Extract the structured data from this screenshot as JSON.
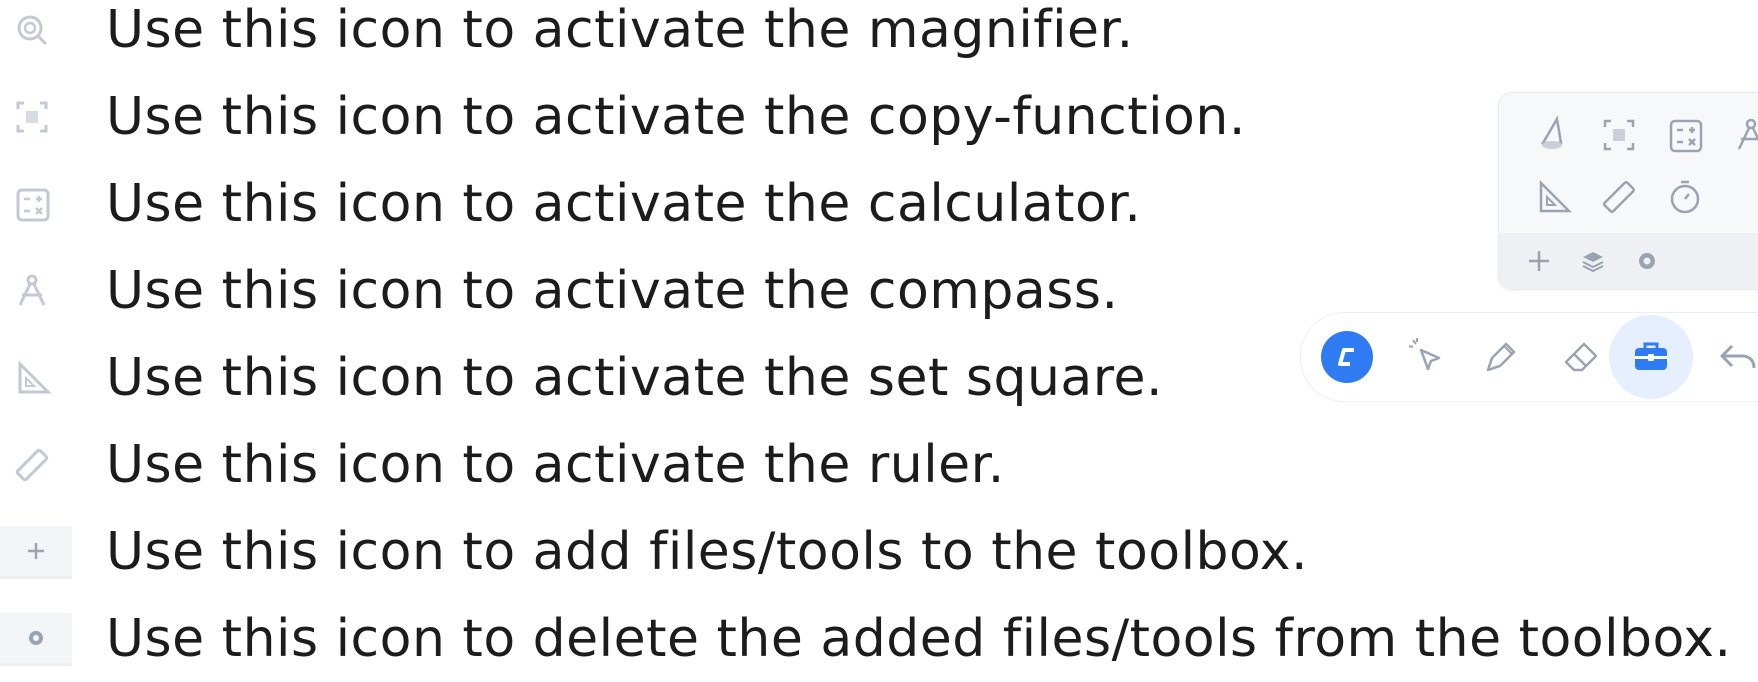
{
  "instructions": [
    {
      "icon": "magnifier-icon",
      "text": "Use this icon to activate the magnifier."
    },
    {
      "icon": "copy-function-icon",
      "text": "Use this icon to activate the copy-function."
    },
    {
      "icon": "calculator-icon",
      "text": "Use this icon to activate the calculator."
    },
    {
      "icon": "compass-icon",
      "text": "Use this icon to activate the compass."
    },
    {
      "icon": "set-square-icon",
      "text": "Use this icon to activate the set square."
    },
    {
      "icon": "ruler-icon",
      "text": "Use this icon to activate the ruler."
    },
    {
      "icon": "add-icon",
      "text": "Use this icon to add files/tools to the toolbox."
    },
    {
      "icon": "delete-icon",
      "text": "Use this icon to delete the added files/tools from the toolbox."
    }
  ],
  "toolbox": {
    "tools": [
      "magnifier-icon",
      "copy-function-icon",
      "calculator-icon",
      "compass-icon",
      "set-square-icon",
      "ruler-icon",
      "timer-icon"
    ],
    "footer": [
      "add-icon",
      "layers-icon",
      "delete-icon"
    ]
  },
  "toolbar": {
    "buttons": [
      "app-logo-icon",
      "pointer-icon",
      "pen-icon",
      "eraser-icon",
      "toolbox-icon",
      "undo-icon"
    ],
    "active": "toolbox-icon",
    "logo_color": "#2f7bf2"
  },
  "colors": {
    "icon_gray": "#9aa3b2",
    "text": "#1c1c1c",
    "accent": "#2f7bf2"
  }
}
